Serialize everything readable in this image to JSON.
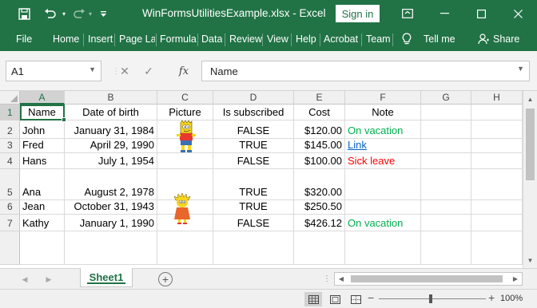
{
  "titlebar": {
    "title": "WinFormsUtilitiesExample.xlsx  -  Excel",
    "signin": "Sign in",
    "save_icon": "save-icon",
    "undo_icon": "undo-icon",
    "redo_icon": "redo-icon",
    "customize_icon": "customize-quick-access-icon",
    "ribbon_display_icon": "ribbon-display-options-icon",
    "minimize_icon": "minimize-icon",
    "maximize_icon": "maximize-icon",
    "close_icon": "close-icon"
  },
  "ribbon": {
    "tabs": [
      "File",
      "Home",
      "Insert",
      "Page La",
      "Formula",
      "Data",
      "Review",
      "View",
      "Help",
      "Acrobat",
      "Team"
    ],
    "tellme": "Tell me",
    "share": "Share"
  },
  "formula_bar": {
    "namebox": "A1",
    "fx": "fx",
    "value": "Name"
  },
  "grid": {
    "columns": [
      "A",
      "B",
      "C",
      "D",
      "E",
      "F",
      "G",
      "H"
    ],
    "rows": [
      "1",
      "2",
      "3",
      "4",
      "5",
      "6",
      "7"
    ],
    "headers": [
      "Name",
      "Date of birth",
      "Picture",
      "Is subscribed",
      "Cost",
      "Note"
    ],
    "data": [
      {
        "name": "John",
        "dob": "January 31, 1984",
        "subscribed": "FALSE",
        "cost": "$120.00",
        "note": "On vacation",
        "note_style": "green"
      },
      {
        "name": "Fred",
        "dob": "April 29, 1990",
        "subscribed": "TRUE",
        "cost": "$145.00",
        "note": "Link",
        "note_style": "link"
      },
      {
        "name": "Hans",
        "dob": "July 1, 1954",
        "subscribed": "FALSE",
        "cost": "$100.00",
        "note": "Sick leave",
        "note_style": "red"
      },
      {
        "name": "Ana",
        "dob": "August 2, 1978",
        "subscribed": "TRUE",
        "cost": "$320.00",
        "note": "",
        "note_style": ""
      },
      {
        "name": "Jean",
        "dob": "October 31, 1943",
        "subscribed": "TRUE",
        "cost": "$250.50",
        "note": "",
        "note_style": ""
      },
      {
        "name": "Kathy",
        "dob": "January 1, 1990",
        "subscribed": "FALSE",
        "cost": "$426.12",
        "note": "On vacation",
        "note_style": "green"
      }
    ]
  },
  "sheets": {
    "active": "Sheet1"
  },
  "status": {
    "zoom": "100%",
    "zoom_level_percent": 100
  },
  "colors": {
    "accent": "#217346",
    "note_green": "#00b050",
    "note_red": "#ff0000",
    "link": "#0563c1"
  }
}
